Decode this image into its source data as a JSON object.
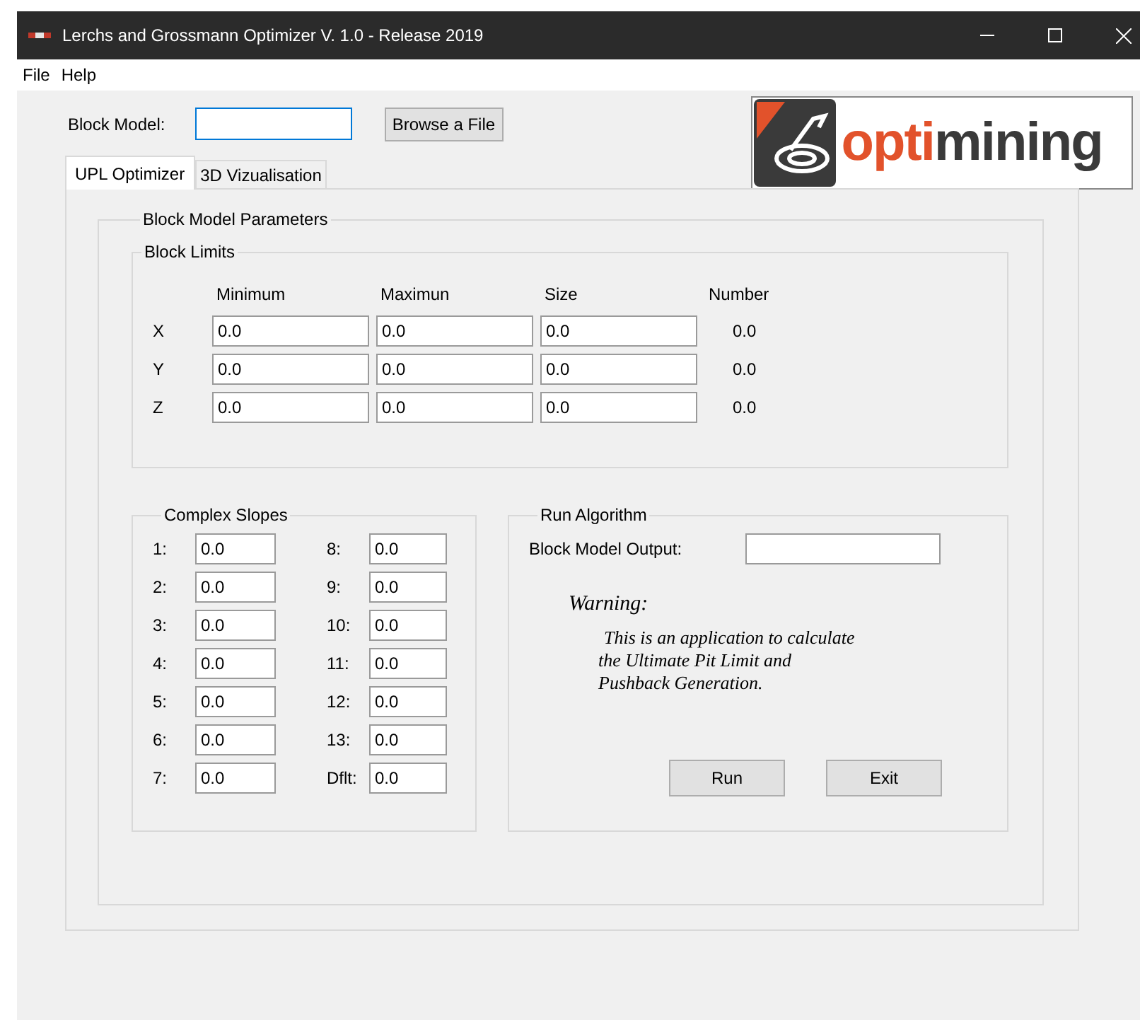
{
  "window": {
    "title": "Lerchs and Grossmann Optimizer V. 1.0 - Release 2019"
  },
  "menu": [
    "File",
    "Help"
  ],
  "block_model": {
    "label": "Block Model:",
    "button": "Browse a File"
  },
  "logo": [
    {
      "text": "opti",
      "kind": "accent"
    },
    {
      "text": "mining",
      "kind": "plain"
    }
  ],
  "tabs": [
    {
      "label": "UPL Optimizer",
      "selected": true
    },
    {
      "label": "3D Vizualisation",
      "selected": false
    }
  ],
  "parameters": {
    "title": "Block Model Parameters",
    "block_limits": {
      "title": "Block Limits",
      "columns": [
        "Minimum",
        "Maximun",
        "Size",
        "Number"
      ],
      "rows": [
        {
          "axis": "X",
          "minimum": "0.0",
          "maximum": "0.0",
          "size": "0.0",
          "number": "0.0"
        },
        {
          "axis": "Y",
          "minimum": "0.0",
          "maximum": "0.0",
          "size": "0.0",
          "number": "0.0"
        },
        {
          "axis": "Z",
          "minimum": "0.0",
          "maximum": "0.0",
          "size": "0.0",
          "number": "0.0"
        }
      ]
    },
    "complex_slopes": {
      "title": "Complex Slopes",
      "left": [
        {
          "label": "1:",
          "value": "0.0"
        },
        {
          "label": "2:",
          "value": "0.0"
        },
        {
          "label": "3:",
          "value": "0.0"
        },
        {
          "label": "4:",
          "value": "0.0"
        },
        {
          "label": "5:",
          "value": "0.0"
        },
        {
          "label": "6:",
          "value": "0.0"
        },
        {
          "label": "7:",
          "value": "0.0"
        }
      ],
      "right": [
        {
          "label": "8:",
          "value": "0.0"
        },
        {
          "label": "9:",
          "value": "0.0"
        },
        {
          "label": "10:",
          "value": "0.0"
        },
        {
          "label": "11:",
          "value": "0.0"
        },
        {
          "label": "12:",
          "value": "0.0"
        },
        {
          "label": "13:",
          "value": "0.0"
        },
        {
          "label": "Dflt:",
          "value": "0.0"
        }
      ]
    },
    "run_algorithm": {
      "title": "Run Algorithm",
      "output_label": "Block Model Output:",
      "warning_title": "Warning:",
      "warning_text": [
        "This is an application to calculate",
        "the Ultimate Pit Limit and",
        "Pushback Generation."
      ],
      "buttons": [
        "Run",
        "Exit"
      ]
    }
  }
}
